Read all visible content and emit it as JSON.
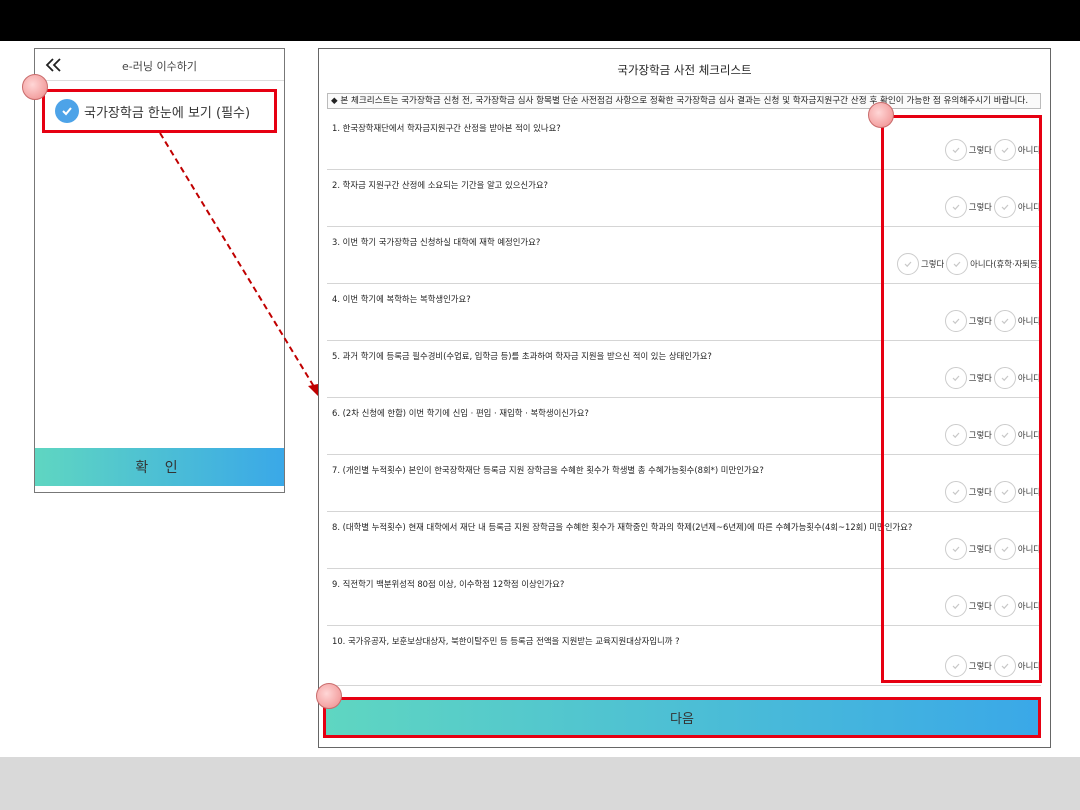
{
  "mobile": {
    "title": "e-러닝 이수하기",
    "checkbox_label": "국가장학금 한눈에 보기 (필수)",
    "confirm_label": "확 인"
  },
  "checklist": {
    "title": "국가장학금 사전 체크리스트",
    "notice": "◆ 본 체크리스트는 국가장학금 신청 전, 국가장학금 심사 항목별 단순 사전점검 사항으로 정확한 국가장학금 심사 결과는 신청 및 학자금지원구간 산정 후 확인이 가능한 점 유의해주시기 바랍니다.",
    "questions": [
      {
        "text": "1. 한국장학재단에서 학자금지원구간 산정을 받아본 적이 있나요?",
        "yes": "그렇다",
        "no": "아니다"
      },
      {
        "text": "2. 학자금 지원구간 산정에 소요되는 기간을 알고 있으신가요?",
        "yes": "그렇다",
        "no": "아니다"
      },
      {
        "text": "3. 이번 학기 국가장학금 신청하실 대학에 재학 예정인가요?",
        "yes": "그렇다",
        "no": "아니다(휴학·자퇴등)"
      },
      {
        "text": "4. 이번 학기에 복학하는 복학생인가요?",
        "yes": "그렇다",
        "no": "아니다"
      },
      {
        "text": "5. 과거 학기에 등록금 필수경비(수업료, 입학금 등)를 초과하여 학자금 지원을 받으신 적이 있는 상태인가요?",
        "yes": "그렇다",
        "no": "아니다"
      },
      {
        "text": "6. (2차 신청에 한함) 이번 학기에 신입 · 편입 · 재입학 · 복학생이신가요?",
        "yes": "그렇다",
        "no": "아니다"
      },
      {
        "text": "7. (개인별 누적횟수) 본인이 한국장학재단 등록금 지원 장학금을 수혜한 횟수가 학생별 총 수혜가능횟수(8회*) 미만인가요?",
        "yes": "그렇다",
        "no": "아니다"
      },
      {
        "text": "8. (대학별 누적횟수) 현재 대학에서 재단 내 등록금 지원 장학금을 수혜한 횟수가 재학중인 학과의 학제(2년제~6년제)에 따른 수혜가능횟수(4회~12회) 미만인가요?",
        "yes": "그렇다",
        "no": "아니다"
      },
      {
        "text": "9. 직전학기 백분위성적 80점 이상, 이수학점 12학점 이상인가요?",
        "yes": "그렇다",
        "no": "아니다"
      },
      {
        "text": "10. 국가유공자, 보훈보상대상자, 북한이탈주민 등 등록금 전액을 지원받는 교육지원대상자입니까 ?",
        "yes": "그렇다",
        "no": "아니다"
      }
    ],
    "next_label": "다음"
  },
  "colors": {
    "highlight": "#e60012",
    "button_gradient_start": "#5fd6c1",
    "button_gradient_end": "#3aa8e8",
    "check_blue": "#4da3e8"
  },
  "icons": {
    "back": "double-chevron-left-icon",
    "check": "check-circle-icon",
    "radio": "radio-check-icon"
  }
}
